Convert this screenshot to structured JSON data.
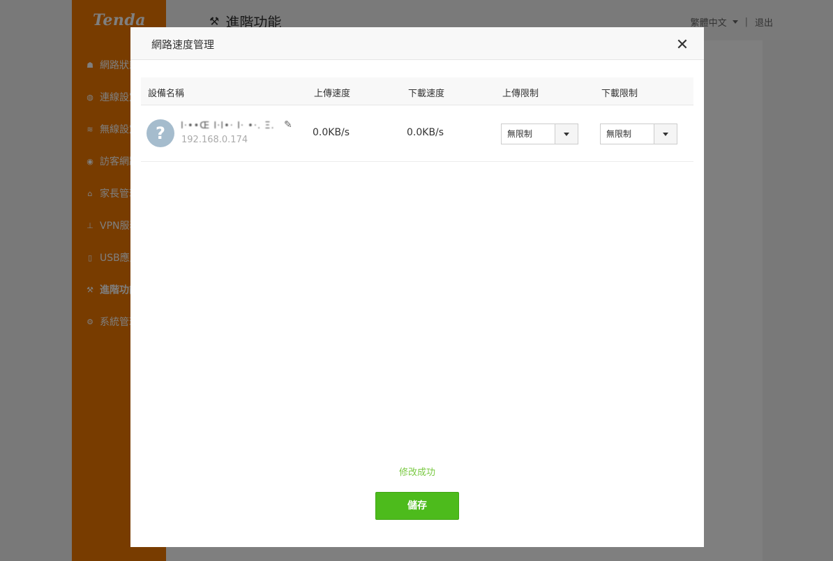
{
  "brand": "Tenda",
  "sidebar": {
    "items": [
      {
        "label": "網路狀態",
        "icon": "router-icon"
      },
      {
        "label": "連線設定",
        "icon": "globe-icon"
      },
      {
        "label": "無線設定",
        "icon": "wifi-icon"
      },
      {
        "label": "訪客網路",
        "icon": "guest-icon"
      },
      {
        "label": "家長管理",
        "icon": "parental-icon"
      },
      {
        "label": "VPN服務",
        "icon": "vpn-icon"
      },
      {
        "label": "USB應用",
        "icon": "usb-icon"
      },
      {
        "label": "進階功能",
        "icon": "wrench-icon",
        "active": true
      },
      {
        "label": "系統管理",
        "icon": "gear-icon"
      }
    ]
  },
  "header": {
    "title": "進階功能",
    "language": "繁體中文",
    "separator": "|",
    "logout": "退出"
  },
  "modal": {
    "title": "網路速度管理",
    "close": "✕",
    "columns": {
      "device": "設備名稱",
      "upload_speed": "上傳速度",
      "download_speed": "下載速度",
      "upload_limit": "上傳限制",
      "download_limit": "下載限制"
    },
    "rows": [
      {
        "avatar": "?",
        "name": "I·••Œ I·I•· I· •·. Ξ.",
        "ip": "192.168.0.174",
        "upload_speed": "0.0KB/s",
        "download_speed": "0.0KB/s",
        "upload_limit": "無限制",
        "download_limit": "無限制"
      }
    ],
    "status": "修改成功",
    "save": "儲存"
  }
}
